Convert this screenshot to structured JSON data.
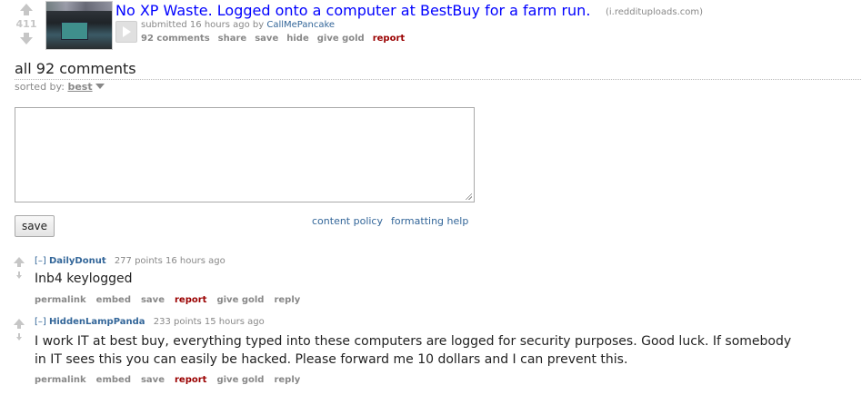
{
  "post": {
    "score": "411",
    "title": "No XP Waste. Logged onto a computer at BestBuy for a farm run.",
    "domain": "(i.reddituploads.com)",
    "submitted_prefix": "submitted 16 hours ago by",
    "author": "CallMePancake",
    "buttons": [
      "92 comments",
      "share",
      "save",
      "hide",
      "give gold",
      "report"
    ]
  },
  "comments_area": {
    "header": "all 92 comments",
    "sorted_label": "sorted by:",
    "sort_value": "best"
  },
  "reply_form": {
    "save_label": "save",
    "content_policy": "content policy",
    "formatting_help": "formatting help"
  },
  "comments": [
    {
      "expand": "[–]",
      "author": "DailyDonut",
      "meta": "277 points 16 hours ago",
      "body": "Inb4 keylogged",
      "buttons": [
        "permalink",
        "embed",
        "save",
        "report",
        "give gold",
        "reply"
      ]
    },
    {
      "expand": "[–]",
      "author": "HiddenLampPanda",
      "meta": "233 points 15 hours ago",
      "body_line1": "I work IT at best buy, everything typed into these computers are logged for security purposes. Good luck. If somebody",
      "body_line2": "in IT sees this you can easily be hacked. Please forward me 10 dollars and I can prevent this.",
      "buttons": [
        "permalink",
        "embed",
        "save",
        "report",
        "give gold",
        "reply"
      ]
    }
  ],
  "colors": {
    "title_link": "#0000ff",
    "author_link": "#336699",
    "report": "#9a0000",
    "muted": "#888888",
    "arrow": "#c6c6c6"
  },
  "icons": [
    "upvote-arrow-icon",
    "downvote-arrow-icon",
    "play-expando-icon",
    "dropdown-triangle-icon",
    "resize-grip-icon"
  ]
}
